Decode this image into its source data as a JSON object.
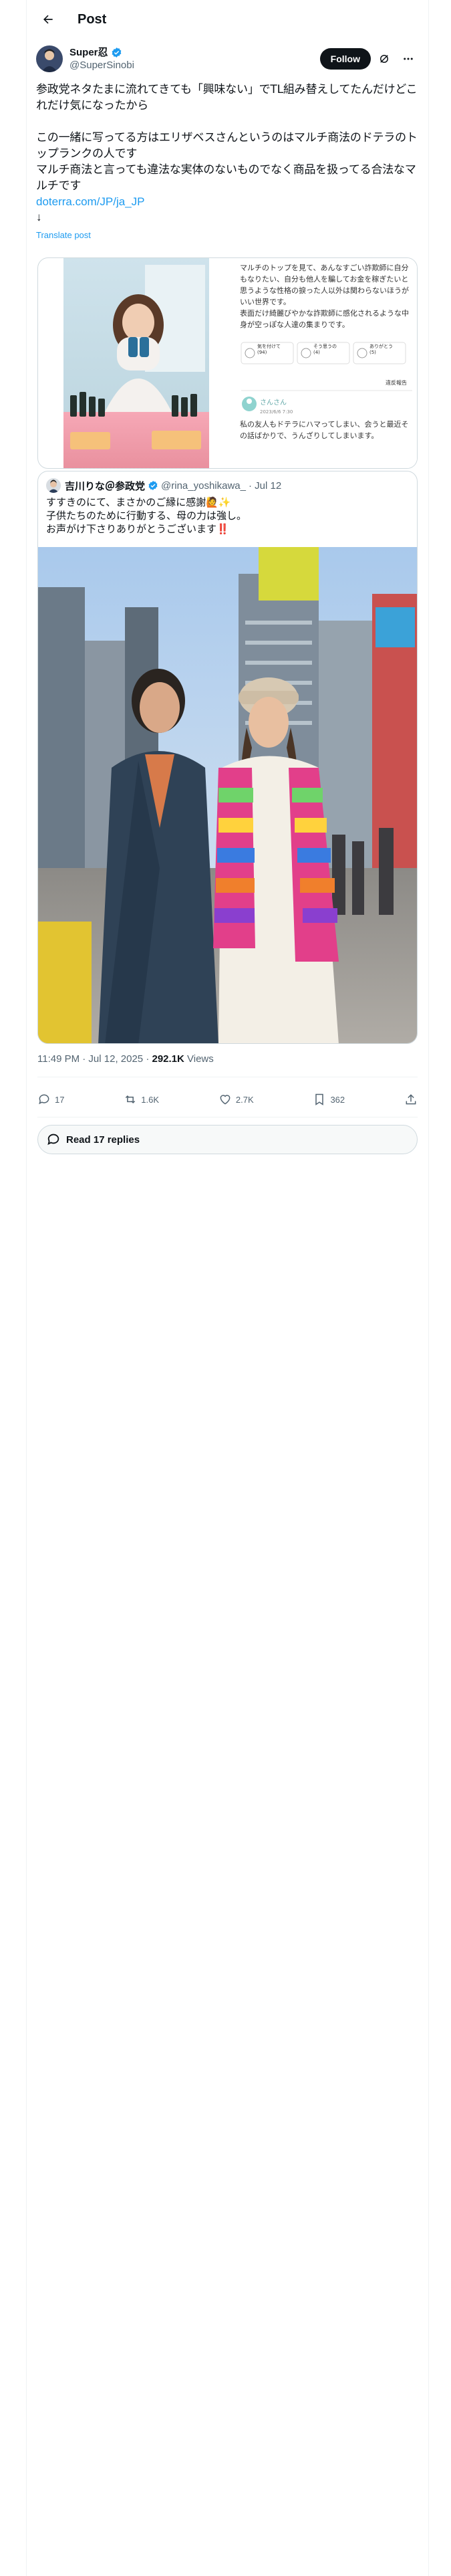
{
  "header": {
    "title": "Post"
  },
  "author": {
    "name": "Super忍",
    "handle": "@SuperSinobi",
    "follow_label": "Follow"
  },
  "post": {
    "text": "参政党ネタたまに流れてきても「興味ない」でTL組み替えしてたんだけどこれだけ気になったから\n\nこの一緒に写ってる方はエリザベスさんというのはマルチ商法のドテラのトップランクの人です\nマルチ商法と言っても違法な実体のないものでなく商品を扱ってる合法なマルチです",
    "link": "doterra.com/JP/ja_JP",
    "arrow": "↓",
    "translate": "Translate post"
  },
  "screenshot": {
    "para": "マルチのトップを見て、あんなすごい詐欺師に自分もなりたい、自分も他人を騙してお金を稼ぎたいと思うような性格の捩った人以外は関わらないほうがいい世界です。\n表面だけ綺麗びやかな詐欺師に感化されるような中身が空っぽな人達の集まりです。",
    "btn1": "気を付けて\n(94)",
    "btn2": "そう思うの\n(4)",
    "btn3": "ありがとう\n(5)",
    "report": "違反報告",
    "commenter": "さんさん",
    "comment_date": "2023/6/6 7:30",
    "comment": "私の友人もドテラにハマってしまい、会うと最近その話ばかりで、うんざりしてしまいます。"
  },
  "quote": {
    "name": "吉川りな＠参政党",
    "handle": "@rina_yoshikawa_",
    "date": "· Jul 12",
    "text": "すすきのにて、まさかのご縁に感謝🙋✨\n子供たちのために行動する、母の力は強し。\nお声がけ下さりありがとうございます‼️"
  },
  "meta": {
    "time": "11:49 PM · Jul 12, 2025 · ",
    "views": "292.1K",
    "views_label": " Views"
  },
  "actions": {
    "replies": "17",
    "reposts": "1.6K",
    "likes": "2.7K",
    "bookmarks": "362"
  },
  "read_replies": "Read 17 replies"
}
